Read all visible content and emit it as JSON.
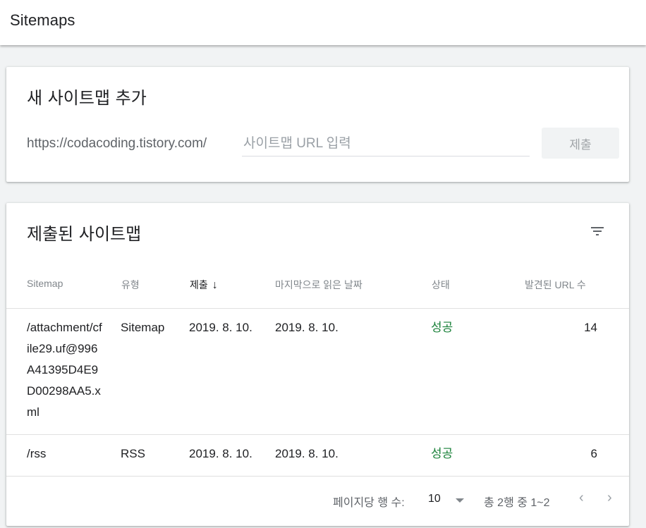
{
  "header": {
    "title": "Sitemaps"
  },
  "add_card": {
    "heading": "새 사이트맵 추가",
    "url_prefix": "https://codacoding.tistory.com/",
    "input_placeholder": "사이트맵 URL 입력",
    "input_value": "",
    "submit_label": "제출"
  },
  "list_card": {
    "heading": "제출된 사이트맵",
    "filter_icon": "filter-icon",
    "columns": {
      "sitemap": "Sitemap",
      "type": "유형",
      "submitted": "제출",
      "last_read": "마지막으로 읽은 날짜",
      "status": "상태",
      "discovered": "발견된 URL 수"
    },
    "sort_indicator": "↓",
    "rows": [
      {
        "sitemap": "/attachment/cfile29.uf@996A41395D4E9D00298AA5.xml",
        "type": "Sitemap",
        "submitted": "2019. 8. 10.",
        "last_read": "2019. 8. 10.",
        "status": "성공",
        "discovered": "14"
      },
      {
        "sitemap": "/rss",
        "type": "RSS",
        "submitted": "2019. 8. 10.",
        "last_read": "2019. 8. 10.",
        "status": "성공",
        "discovered": "6"
      }
    ],
    "footer": {
      "rows_per_page_label": "페이지당 행 수:",
      "rows_per_page_value": "10",
      "range_text": "총 2행 중 1~2",
      "prev_icon": "chevron-left-icon",
      "next_icon": "chevron-right-icon"
    }
  },
  "colors": {
    "status_success": "#188038",
    "text_primary": "#202124",
    "text_secondary": "#5f6368"
  }
}
